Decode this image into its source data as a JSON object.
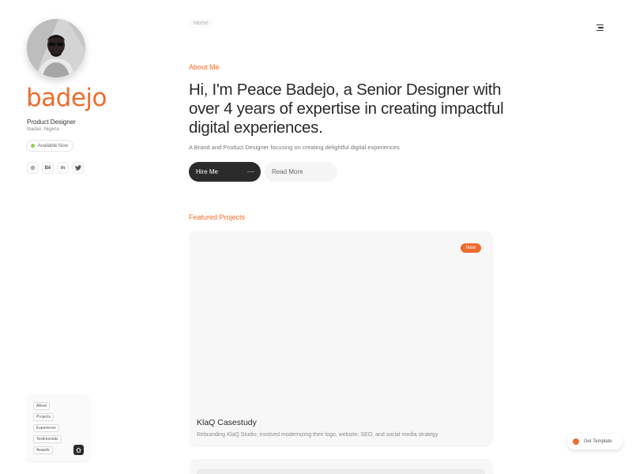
{
  "profile": {
    "name": "badejo",
    "role": "Product Designer",
    "location": "Ibadan, Nigeria",
    "status": "Available Now",
    "socials": [
      {
        "icon": "dribbble-icon",
        "glyph": "◎"
      },
      {
        "icon": "behance-icon",
        "glyph": "Bē"
      },
      {
        "icon": "linkedin-icon",
        "glyph": "in"
      },
      {
        "icon": "twitter-icon",
        "glyph": "🐦"
      }
    ]
  },
  "nav": {
    "items": [
      "About",
      "Projects",
      "Experience",
      "Testimonials",
      "Awards"
    ],
    "home_icon": "home-icon"
  },
  "topbar": {
    "breadcrumb": "Home",
    "menu_icon": "menu-icon"
  },
  "hero": {
    "label": "About Me",
    "title": "Hi, I'm Peace Badejo, a Senior Designer with over 4 years of expertise in creating impactful digital experiences.",
    "subtitle": "A Brand and Product Designer focusing on creating delightful digital experiences",
    "primary_button": "Hire Me",
    "secondary_button": "Read More"
  },
  "projects": {
    "label": "Featured Projects",
    "items": [
      {
        "badge": "New",
        "title": "KlaQ Casestudy",
        "description": "Rebranding KlaQ Studio; involved modernizing their logo, website, SEO, and social media strategy"
      }
    ]
  },
  "floating": {
    "get_template": "Get Template"
  },
  "colors": {
    "accent": "#ef6c2e",
    "dark": "#2b2b2b",
    "status": "#8fd14f"
  }
}
